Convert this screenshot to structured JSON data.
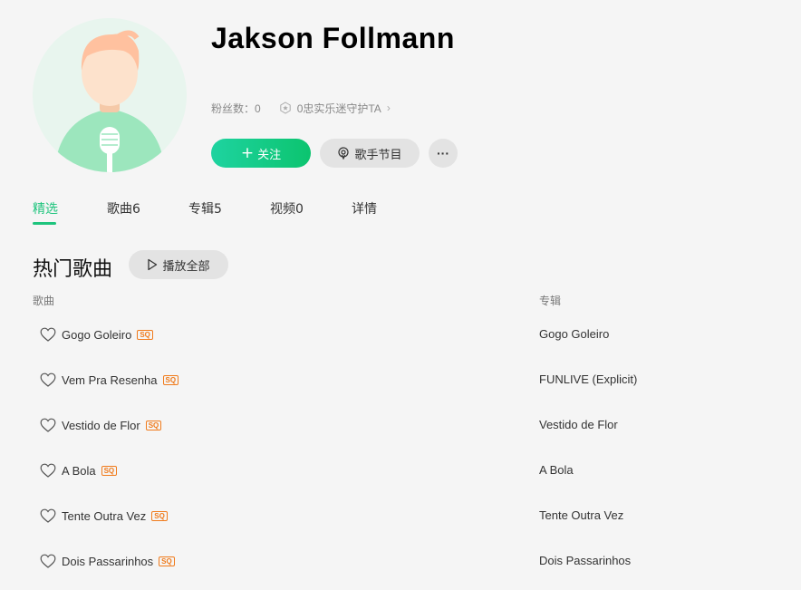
{
  "artist": {
    "name": "Jakson Follmann"
  },
  "stats": {
    "fans": "粉丝数：0",
    "guard": "0忠实乐迷守护TA",
    "chevron": "›"
  },
  "actions": {
    "follow_plus": "+",
    "follow": "关注",
    "program": "歌手节目",
    "more": "···"
  },
  "tabs": [
    "精选",
    "歌曲6",
    "专辑5",
    "视频0",
    "详情"
  ],
  "hot": {
    "title": "热门歌曲",
    "play_all": "播放全部"
  },
  "columns": {
    "song": "歌曲",
    "album": "专辑"
  },
  "songs": [
    {
      "title": "Gogo Goleiro",
      "badge": "SQ",
      "album": "Gogo Goleiro"
    },
    {
      "title": "Vem Pra Resenha",
      "badge": "SQ",
      "album": "FUNLIVE (Explicit)"
    },
    {
      "title": "Vestido de Flor",
      "badge": "SQ",
      "album": "Vestido de Flor"
    },
    {
      "title": "A Bola",
      "badge": "SQ",
      "album": "A Bola"
    },
    {
      "title": "Tente Outra Vez",
      "badge": "SQ",
      "album": "Tente Outra Vez"
    },
    {
      "title": "Dois Passarinhos",
      "badge": "SQ",
      "album": "Dois Passarinhos"
    }
  ],
  "colors": {
    "accent": "#1ec47d",
    "badge": "#f07b1c",
    "background": "#f5f5f5"
  }
}
